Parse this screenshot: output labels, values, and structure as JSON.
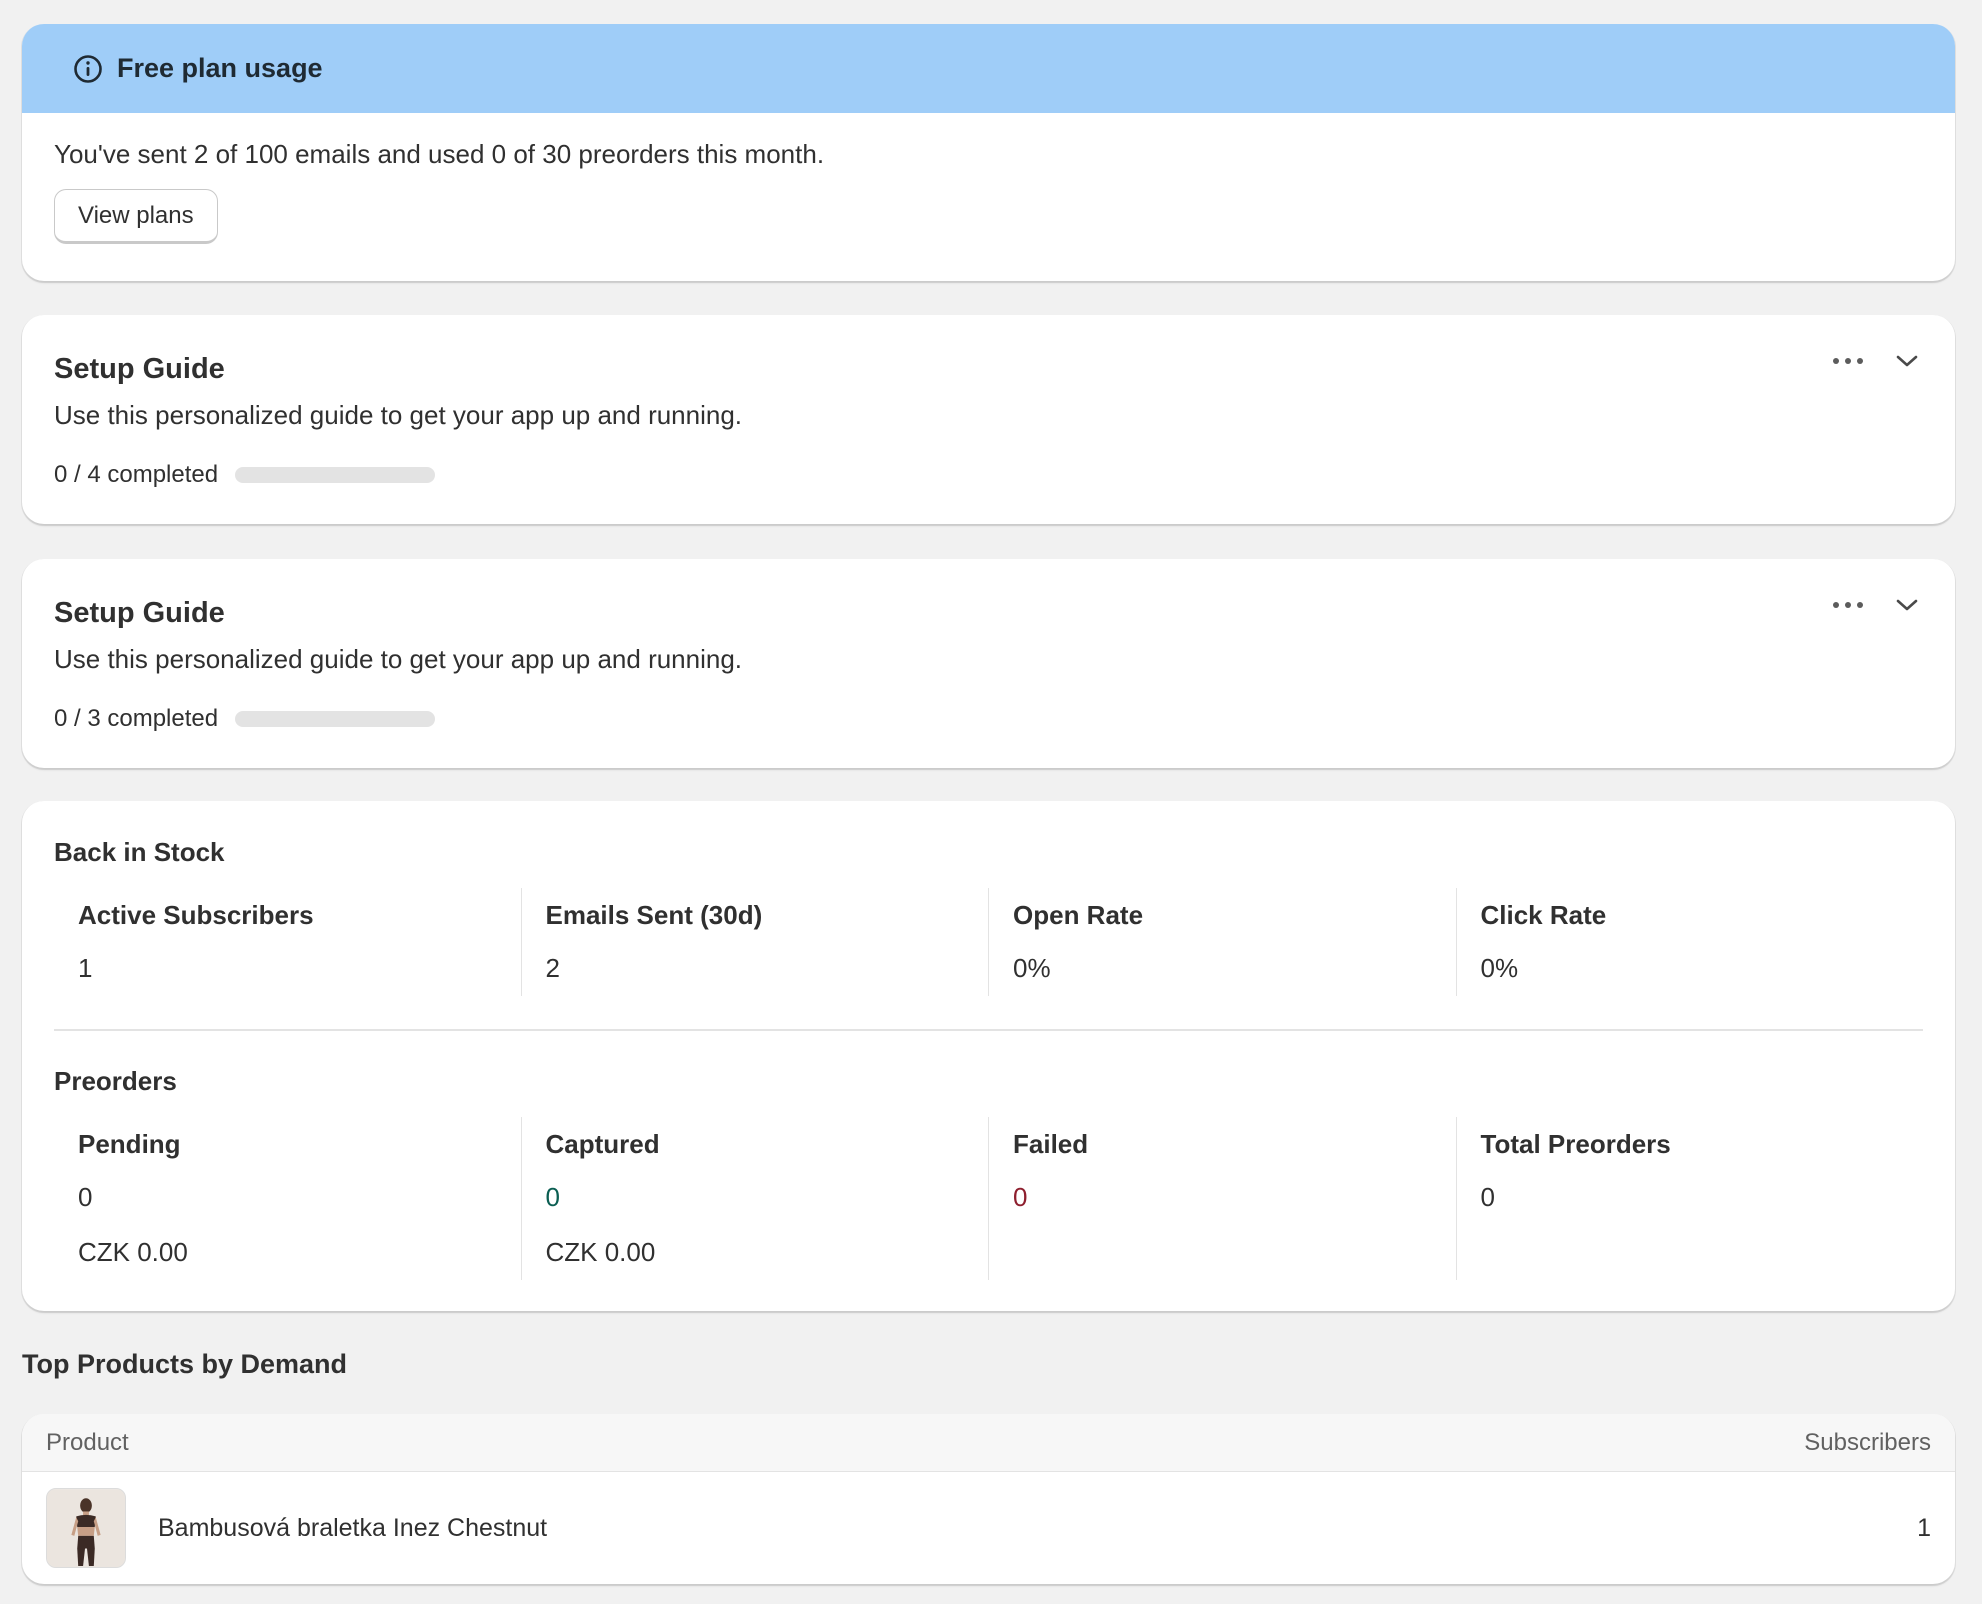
{
  "banner": {
    "title": "Free plan usage",
    "message": "You've sent 2 of 100 emails and used 0 of 30 preorders this month.",
    "button_label": "View plans",
    "icon": "info-icon",
    "background": "#9fcdf8"
  },
  "setup_guides": [
    {
      "title": "Setup Guide",
      "description": "Use this personalized guide to get your app up and running.",
      "progress_label": "0 / 4 completed",
      "completed": 0,
      "total": 4
    },
    {
      "title": "Setup Guide",
      "description": "Use this personalized guide to get your app up and running.",
      "progress_label": "0 / 3 completed",
      "completed": 0,
      "total": 3
    }
  ],
  "back_in_stock": {
    "title": "Back in Stock",
    "metrics": [
      {
        "label": "Active Subscribers",
        "value": "1"
      },
      {
        "label": "Emails Sent (30d)",
        "value": "2"
      },
      {
        "label": "Open Rate",
        "value": "0%"
      },
      {
        "label": "Click Rate",
        "value": "0%"
      }
    ]
  },
  "preorders": {
    "title": "Preorders",
    "metrics": [
      {
        "label": "Pending",
        "value": "0",
        "amount": "CZK 0.00"
      },
      {
        "label": "Captured",
        "value": "0",
        "amount": "CZK 0.00",
        "color": "#0b5e52"
      },
      {
        "label": "Failed",
        "value": "0",
        "color": "#8e1f2e"
      },
      {
        "label": "Total Preorders",
        "value": "0"
      }
    ]
  },
  "top_products": {
    "title": "Top Products by Demand",
    "columns": [
      "Product",
      "Subscribers"
    ],
    "rows": [
      {
        "name": "Bambusová braletka Inez Chestnut",
        "subscribers": "1"
      }
    ]
  }
}
